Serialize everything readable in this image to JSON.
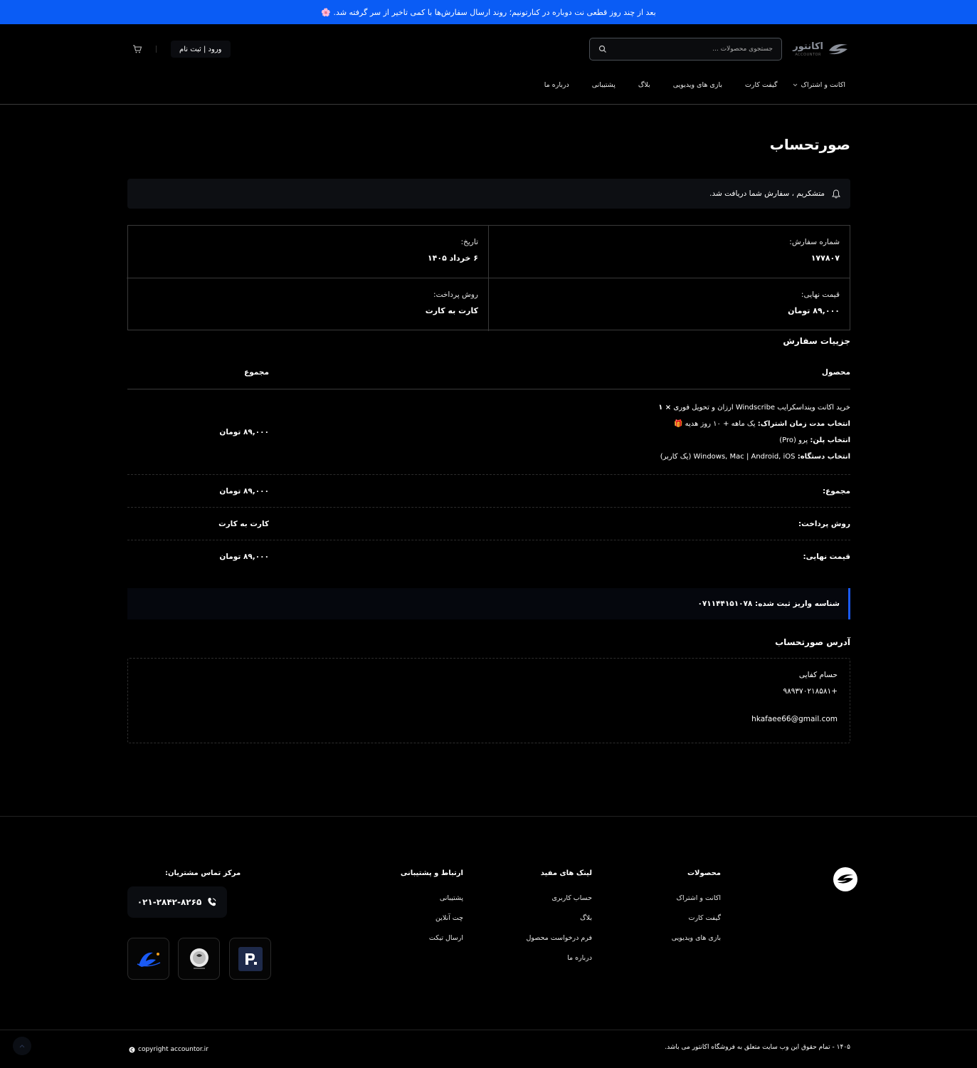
{
  "announcement": "بعد از چند روز قطعی نت دوباره در کنارتونیم؛ روند ارسال سفارش‌ها با کمی تاخیر از سر گرفته شد. 🌸",
  "header": {
    "logo_text": "اکانتور",
    "logo_sub": "ACCOUNTOR",
    "search_placeholder": "جستجوی محصولات ...",
    "login_label": "ورود | ثبت نام",
    "nav": [
      "اکانت و اشتراک",
      "گیفت کارت",
      "بازی های ویدیویی",
      "بلاگ",
      "پشتیبانی",
      "درباره ما"
    ]
  },
  "page": {
    "title": "صورتحساب",
    "notice": "متشکریم ، سفارش شما دریافت شد.",
    "summary": {
      "order_label": "شماره سفارش:",
      "order_value": "۱۷۷۸۰۷",
      "date_label": "تاریخ:",
      "date_value": "۶ خرداد ۱۴۰۵",
      "total_label": "قیمت نهایی:",
      "total_value": "۸۹,۰۰۰ تومان",
      "method_label": "روش پرداخت:",
      "method_value": "کارت به کارت"
    },
    "details_title": "جزییات سفارش",
    "table": {
      "head_product": "محصول",
      "head_total": "مجموع",
      "product_name": "خرید اکانت وینداسکرایب Windscribe ارزان و تحویل فوری",
      "product_qty": "× ۱",
      "meta": [
        {
          "label": "انتخاب مدت زمان اشتراک:",
          "value": "یک ماهه + ۱۰ روز هدیه 🎁"
        },
        {
          "label": "انتخاب پلن:",
          "value": "پرو (Pro)"
        },
        {
          "label": "انتخاب دستگاه:",
          "value": "Windows, Mac | Android, iOS (یک کاربر)"
        }
      ],
      "product_price": "۸۹,۰۰۰ تومان",
      "rows": [
        {
          "label": "مجموع:",
          "value": "۸۹,۰۰۰ تومان"
        },
        {
          "label": "روش پرداخت:",
          "value": "کارت به کارت"
        },
        {
          "label": "قیمت نهایی:",
          "value": "۸۹,۰۰۰ تومان"
        }
      ]
    },
    "transaction": "شناسه واریز ثبت شده: ۰۷۱۱۴۴۱۵۱۰۷۸",
    "address_title": "آدرس صورتحساب",
    "address": {
      "name": "حسام کفایی",
      "phone": "+۹۸۹۳۷۰۲۱۸۵۸۱",
      "email": "hkafaee66@gmail.com"
    }
  },
  "footer": {
    "col1_title": "محصولات",
    "col1": [
      "اکانت و اشتراک",
      "گیفت کارت",
      "بازی های ویدیویی"
    ],
    "col2_title": "لینک های مفید",
    "col2": [
      "حساب کاربری",
      "بلاگ",
      "فرم درخواست محصول",
      "درباره ما"
    ],
    "col3_title": "ارتباط و پشتیبانی",
    "col3": [
      "پشتیبانی",
      "چت آنلاین",
      "ارسال تیکت"
    ],
    "contact_title": "مرکز تماس مشتریان:",
    "phone": "۰۲۱-۲۸۴۲-۸۲۶۵",
    "copyright_fa": "۱۴۰۵ - تمام حقوق این وب سایت متعلق به فروشگاه اکانتور می باشد.",
    "copyright_en": "copyright accountor.ir"
  },
  "colors": {
    "accent": "#0a5cf5",
    "background": "#000000",
    "panel": "#0d0f13"
  }
}
